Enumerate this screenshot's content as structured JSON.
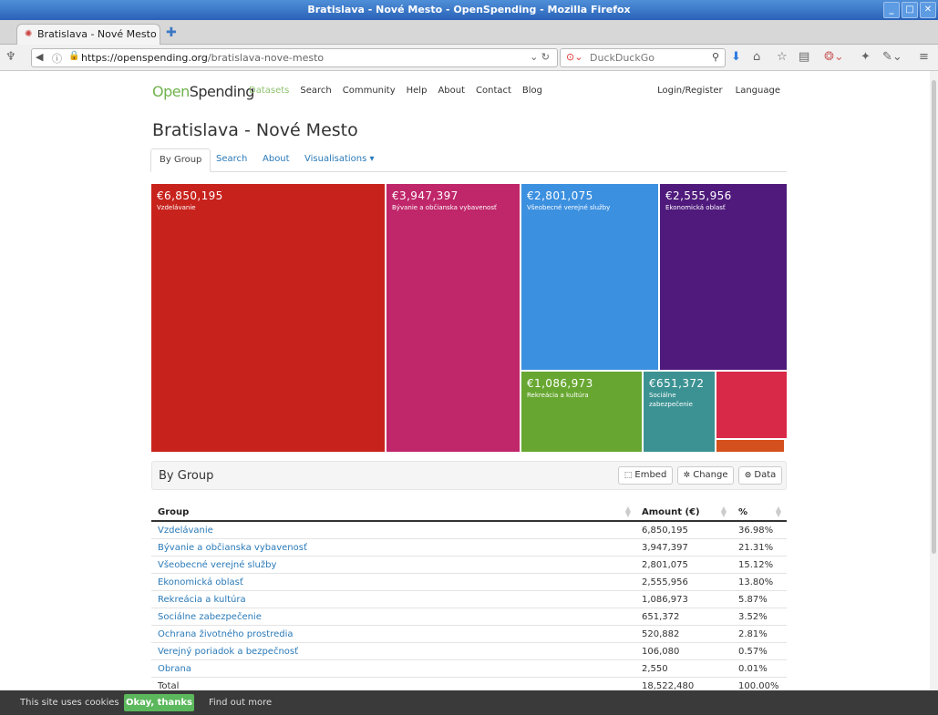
{
  "window": {
    "title": "Bratislava - Nové Mesto - OpenSpending - Mozilla Firefox"
  },
  "browser": {
    "tab_title": "Bratislava - Nové Mesto - ...",
    "url_host": "https://openspending.org",
    "url_path": "/bratislava-nove-mesto",
    "search_placeholder": "DuckDuckGo"
  },
  "site": {
    "brand_open": "Open",
    "brand_spending": "Spending",
    "nav": [
      "Datasets",
      "Search",
      "Community",
      "Help",
      "About",
      "Contact",
      "Blog"
    ],
    "login": "Login/Register",
    "language": "Language",
    "page_title": "Bratislava - Nové Mesto",
    "tabs": [
      "By Group",
      "Search",
      "About",
      "Visualisations ▾"
    ]
  },
  "treemap": [
    {
      "value": "€6,850,195",
      "label": "Vzdelávanie",
      "color": "#c8221c"
    },
    {
      "value": "€3,947,397",
      "label": "Bývanie a občianska vybavenosť",
      "color": "#c0266a"
    },
    {
      "value": "€2,801,075",
      "label": "Všeobecné verejné služby",
      "color": "#3c90e0"
    },
    {
      "value": "€2,555,956",
      "label": "Ekonomická oblasť",
      "color": "#4f1a7c"
    },
    {
      "value": "€1,086,973",
      "label": "Rekreácia a kultúra",
      "color": "#67a731"
    },
    {
      "value": "€651,372",
      "label": "Sociálne zabezpečenie",
      "color": "#3c9293"
    },
    {
      "value": "",
      "label": "",
      "color": "#d82a48"
    },
    {
      "value": "",
      "label": "",
      "color": "#d4501c"
    }
  ],
  "group_panel": {
    "title": "By Group",
    "embed": "Embed",
    "change": "Change",
    "data": "Data"
  },
  "table": {
    "headers": [
      "Group",
      "Amount (€)",
      "%"
    ],
    "rows": [
      {
        "group": "Vzdelávanie",
        "amount": "6,850,195",
        "pct": "36.98%"
      },
      {
        "group": "Bývanie a občianska vybavenosť",
        "amount": "3,947,397",
        "pct": "21.31%"
      },
      {
        "group": "Všeobecné verejné služby",
        "amount": "2,801,075",
        "pct": "15.12%"
      },
      {
        "group": "Ekonomická oblasť",
        "amount": "2,555,956",
        "pct": "13.80%"
      },
      {
        "group": "Rekreácia a kultúra",
        "amount": "1,086,973",
        "pct": "5.87%"
      },
      {
        "group": "Sociálne zabezpečenie",
        "amount": "651,372",
        "pct": "3.52%"
      },
      {
        "group": "Ochrana životného prostredia",
        "amount": "520,882",
        "pct": "2.81%"
      },
      {
        "group": "Verejný poriadok a bezpečnosť",
        "amount": "106,080",
        "pct": "0.57%"
      },
      {
        "group": "Obrana",
        "amount": "2,550",
        "pct": "0.01%"
      }
    ],
    "total_label": "Total",
    "total_amount": "18,522,480",
    "total_pct": "100.00%"
  },
  "cookie": {
    "message": "This site uses cookies",
    "ok": "Okay, thanks",
    "more": "Find out more"
  }
}
